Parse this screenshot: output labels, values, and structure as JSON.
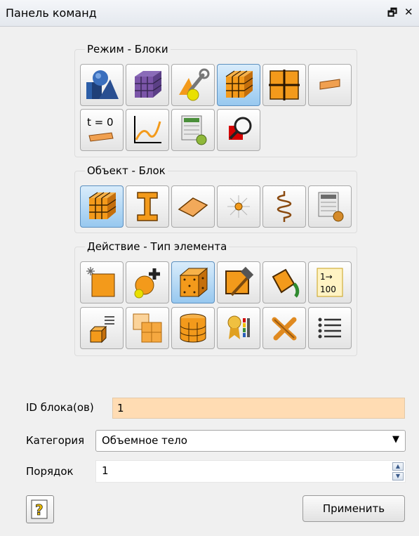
{
  "panel": {
    "title": "Панель команд",
    "float_glyph": "🗗",
    "close_glyph": "✕"
  },
  "groups": {
    "mode": {
      "label": "Режим - Блоки",
      "buttons": [
        {
          "icon": "geometry-volume-icon",
          "active": false
        },
        {
          "icon": "mesh-block-icon",
          "active": false
        },
        {
          "icon": "tools-wrench-icon",
          "active": false
        },
        {
          "icon": "block-cube-icon",
          "active": true
        },
        {
          "icon": "nodes-grid-icon",
          "active": false
        },
        {
          "icon": "boundary-condition-icon",
          "active": false
        },
        {
          "icon": "initial-condition-icon",
          "active": false
        },
        {
          "icon": "graph-curve-icon",
          "active": false
        },
        {
          "icon": "analysis-settings-icon",
          "active": false
        },
        {
          "icon": "zoom-inspect-icon",
          "active": false
        }
      ],
      "initial_condition_text": "t = 0"
    },
    "object": {
      "label": "Объект - Блок",
      "buttons": [
        {
          "icon": "block-cube-icon",
          "active": true
        },
        {
          "icon": "beam-ibeam-icon",
          "active": false
        },
        {
          "icon": "shell-diamond-icon",
          "active": false
        },
        {
          "icon": "spark-point-icon",
          "active": false
        },
        {
          "icon": "spring-coil-icon",
          "active": false
        },
        {
          "icon": "table-settings-icon",
          "active": false
        }
      ]
    },
    "action": {
      "label": "Действие - Тип элемента",
      "buttons": [
        {
          "icon": "new-square-icon",
          "active": false
        },
        {
          "icon": "add-element-icon",
          "active": false
        },
        {
          "icon": "element-type-cube-icon",
          "active": true
        },
        {
          "icon": "hammer-edit-icon",
          "active": false
        },
        {
          "icon": "paint-bucket-icon",
          "active": false
        },
        {
          "icon": "renumber-icon",
          "active": false
        },
        {
          "icon": "list-cube-icon",
          "active": false
        },
        {
          "icon": "split-grid-icon",
          "active": false
        },
        {
          "icon": "cylinder-mesh-icon",
          "active": false
        },
        {
          "icon": "quality-ribbon-icon",
          "active": false
        },
        {
          "icon": "delete-cross-icon",
          "active": false
        },
        {
          "icon": "list-lines-icon",
          "active": false
        }
      ],
      "renumber_top": "1→",
      "renumber_bottom": "100"
    }
  },
  "form": {
    "id_label": "ID блока(ов)",
    "id_value": "1",
    "category_label": "Категория",
    "category_value": "Объемное тело",
    "order_label": "Порядок",
    "order_value": "1"
  },
  "footer": {
    "help_glyph": "?",
    "apply_label": "Применить"
  },
  "colors": {
    "block_orange": "#f39a1b",
    "highlight_input": "#ffdcb3",
    "active_button": "#9fcbf0"
  }
}
